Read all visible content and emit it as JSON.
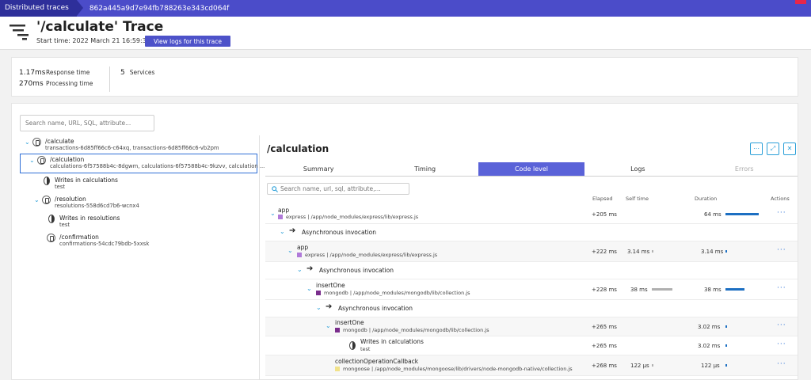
{
  "topbar": {
    "crumb_root": "Distributed traces",
    "crumb_trace_id": "862a445a9d7e94fb788263e343cd064f"
  },
  "header": {
    "title": "'/calculate' Trace",
    "start_time": "Start time: 2022 March 21 16:59:30",
    "view_logs_label": "View logs for this trace"
  },
  "metrics": {
    "response_value": "1.17ms",
    "response_label": "Response time",
    "processing_value": "270ms",
    "processing_label": "Processing time",
    "services_value": "5",
    "services_label": "Services"
  },
  "left": {
    "search_placeholder": "Search name, URL, SQL, attribute...",
    "tree": [
      {
        "title": "/calculate",
        "sub": "transactions-6d85ff66c6-c64xq, transactions-6d85ff66c6-vb2pm"
      },
      {
        "title": "/calculation",
        "sub": "calculations-6f57588b4c-8dgwm, calculations-6f57588b4c-9kzvv, calculation ..."
      },
      {
        "title": "Writes in calculations",
        "sub": "test"
      },
      {
        "title": "/resolution",
        "sub": "resolutions-558d6cd7b6-wcnx4"
      },
      {
        "title": "Writes in resolutions",
        "sub": "test"
      },
      {
        "title": "/confirmation",
        "sub": "confirmations-54cdc79bdb-5xxsk"
      }
    ]
  },
  "detail": {
    "title": "/calculation",
    "tabs": [
      "Summary",
      "Timing",
      "Code level",
      "Logs",
      "Errors"
    ],
    "search_placeholder": "Search name, url, sql, attribute,...",
    "columns": {
      "elapsed": "Elapsed",
      "self": "Self time",
      "duration": "Duration",
      "actions": "Actions"
    },
    "rows": [
      {
        "title": "app",
        "sub": "express | /app/node_modules/express/lib/express.js",
        "color": "#b07ad9",
        "elapsed": "+205 ms",
        "self": "",
        "duration": "64 ms",
        "duration_frac": 0.95,
        "self_frac": 0
      },
      {
        "title": "Asynchronous invocation"
      },
      {
        "title": "app",
        "sub": "express | /app/node_modules/express/lib/express.js",
        "color": "#b07ad9",
        "elapsed": "+222 ms",
        "self": "3.14 ms",
        "duration": "3.14 ms",
        "duration_frac": 0.05,
        "self_frac": 0.05
      },
      {
        "title": "Asynchronous invocation"
      },
      {
        "title": "insertOne",
        "sub": "mongodb | /app/node_modules/mongodb/lib/collection.js",
        "color": "#7a2d8c",
        "elapsed": "+228 ms",
        "self": "38 ms",
        "duration": "38 ms",
        "duration_frac": 0.55,
        "self_frac": 0.55
      },
      {
        "title": "Asynchronous invocation"
      },
      {
        "title": "insertOne",
        "sub": "mongodb | /app/node_modules/mongodb/lib/collection.js",
        "color": "#7a2d8c",
        "elapsed": "+265 ms",
        "self": "",
        "duration": "3.02 ms",
        "duration_frac": 0.05,
        "self_frac": 0
      },
      {
        "title": "Writes in calculations",
        "sub": "test",
        "elapsed": "+265 ms",
        "self": "",
        "duration": "3.02 ms",
        "duration_frac": 0.05,
        "self_frac": 0
      },
      {
        "title": "collectionOperationCallback",
        "sub": "mongoose | /app/node_modules/mongoose/lib/drivers/node-mongodb-native/collection.js",
        "color": "#f1e28a",
        "elapsed": "+268 ms",
        "self": "122 µs",
        "duration": "122 µs",
        "duration_frac": 0.02,
        "self_frac": 0.02
      }
    ]
  },
  "icons": [
    "trace-icon",
    "service-icon",
    "database-icon",
    "chevron-down-icon",
    "arrow-right-icon",
    "more-icon",
    "expand-icon",
    "close-icon",
    "search-icon"
  ]
}
